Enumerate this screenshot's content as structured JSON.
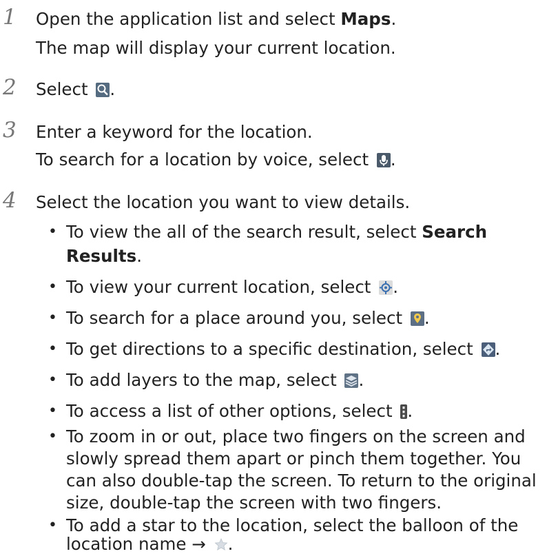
{
  "steps": [
    {
      "number": "1",
      "lines": [
        "Open the application list and select ",
        "Maps",
        ".",
        "The map will display your current location."
      ]
    },
    {
      "number": "2",
      "text_before": "Select ",
      "text_after": "."
    },
    {
      "number": "3",
      "line1": "Enter a keyword for the location.",
      "line2_before": "To search for a location by voice, select ",
      "line2_after": "."
    },
    {
      "number": "4",
      "line1": "Select the location you want to view details."
    }
  ],
  "bullets": {
    "b1_l1_before": "To view the all of the search result, select ",
    "b1_l1_bold": "Search",
    "b1_l2_bold": "Results",
    "b1_l2_after": ".",
    "b2_before": "To view your current location, select ",
    "b2_after": ".",
    "b3_before": "To search for a place around you, select ",
    "b3_after": ".",
    "b4_before": "To get directions to a specific destination, select ",
    "b4_after": ".",
    "b5_before": "To add layers to the map, select ",
    "b5_after": ".",
    "b6_before": "To access a list of other options, select ",
    "b6_after": ".",
    "b7_l1": "To zoom in or out, place two fingers on the screen and",
    "b7_l2": "slowly spread them apart or pinch them together. You",
    "b7_l3": "can also double-tap the screen. To return to the original",
    "b7_l4": "size, double-tap the screen with two fingers.",
    "b8_l1": "To add a star to the location, select the balloon of the",
    "b8_l2_before": "location name → ",
    "b8_l2_after": "."
  },
  "bullet_char": "•",
  "icons": [
    "search-icon",
    "microphone-icon",
    "current-location-icon",
    "places-icon",
    "directions-icon",
    "layers-icon",
    "menu-icon",
    "star-icon"
  ]
}
